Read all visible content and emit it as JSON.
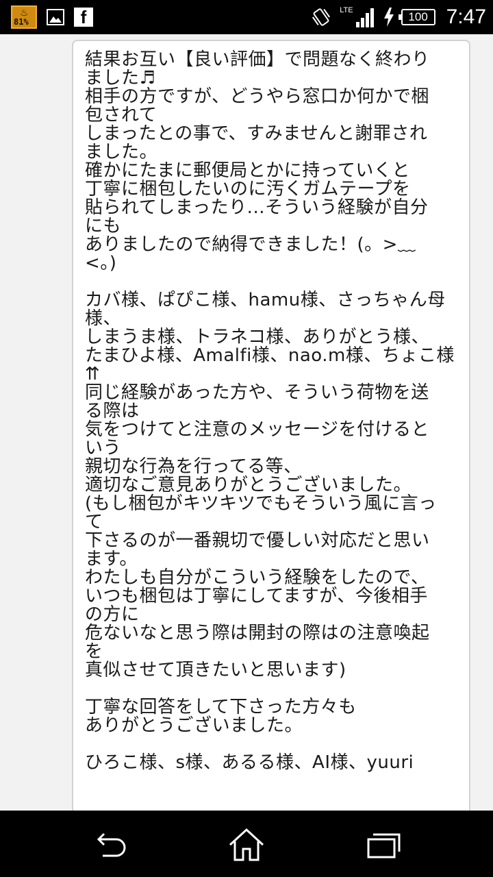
{
  "status_bar": {
    "battery_app_percent": "81%",
    "network": "LTE",
    "battery_level": "100",
    "time": "7:47"
  },
  "message": {
    "lines": [
      "結果お互い【良い評価】で問題なく終わり",
      "ました♬",
      "相手の方ですが、どうやら窓口か何かで梱",
      "包されて",
      "しまったとの事で、すみませんと謝罪され",
      "ました。",
      "確かにたまに郵便局とかに持っていくと",
      "丁寧に梱包したいのに汚くガムテープを",
      "貼られてしまったり...そういう経験が自分",
      "にも",
      "ありましたので納得できました！(。>﹏",
      "<。)",
      "",
      "カバ様、ぱぴこ様、hamu様、さっちゃん母",
      "様、",
      "しまうま様、トラネコ様、ありがとう様、",
      "たまひよ様、Amalfi様、nao.m様、ちょこ様",
      "⇈",
      "同じ経験があった方や、そういう荷物を送",
      "る際は",
      "気をつけてと注意のメッセージを付けると",
      "いう",
      "親切な行為を行ってる等、",
      "適切なご意見ありがとうございました。",
      "(もし梱包がキツキツでもそういう風に言っ",
      "て",
      "下さるのが一番親切で優しい対応だと思い",
      "ます。",
      "わたしも自分がこういう経験をしたので、",
      "いつも梱包は丁寧にしてますが、今後相手",
      "の方に",
      "危ないなと思う際は開封の際はの注意喚起",
      "を",
      "真似させて頂きたいと思います)",
      "",
      "丁寧な回答をして下さった方々も",
      "ありがとうございました。",
      "",
      "ひろこ様、s様、あるる様、AI様、yuuri"
    ]
  },
  "nav": {
    "back_icon": "back-arrow",
    "home_icon": "house",
    "recent_icon": "stacked-windows"
  }
}
